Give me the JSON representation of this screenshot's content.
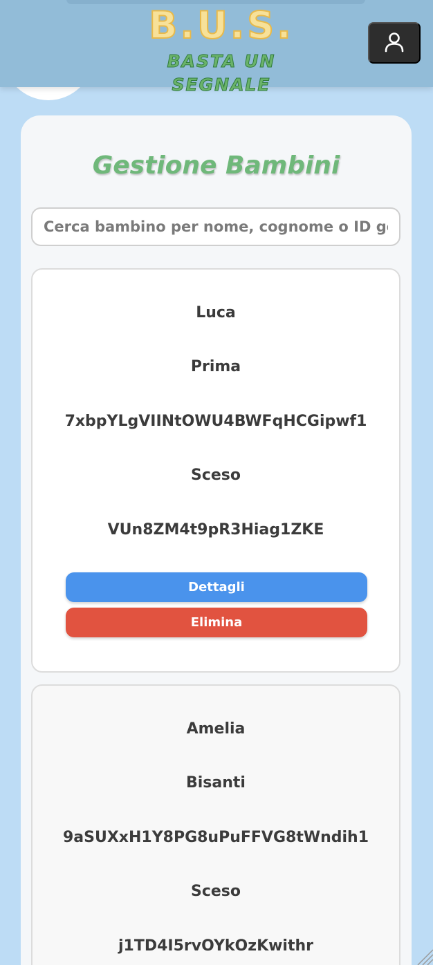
{
  "header": {
    "logo_title": "B.U.S.",
    "logo_subtitle": "BASTA UN SEGNALE",
    "profile_icon": "user-icon"
  },
  "main": {
    "title": "Gestione Bambini",
    "search": {
      "placeholder": "Cerca bambino per nome, cognome o ID genitore",
      "value": ""
    },
    "children": [
      {
        "nome": "Luca",
        "cognome": "Prima",
        "id_genitore": "7xbpYLgVIINtOWU4BWFqHCGipwf1",
        "stato": "Sceso",
        "id_bambino": "VUn8ZM4t9pR3Hiag1ZKE",
        "details_label": "Dettagli",
        "delete_label": "Elimina"
      },
      {
        "nome": "Amelia",
        "cognome": "Bisanti",
        "id_genitore": "9aSUXxH1Y8PG8uPuFFVG8tWndih1",
        "stato": "Sceso",
        "id_bambino": "j1TD4I5rvOYkOzKwithr"
      }
    ]
  },
  "colors": {
    "background": "#bddcf5",
    "header": "#92bcd8",
    "title_green": "#6fb87a",
    "details_blue": "#4a93ec",
    "delete_red": "#e15340",
    "profile_button": "#2d2d2d"
  }
}
